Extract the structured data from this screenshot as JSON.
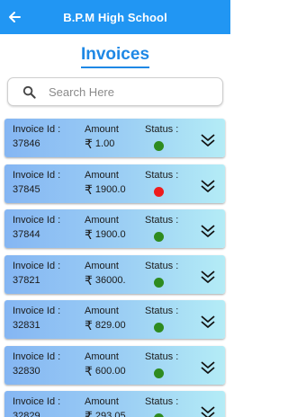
{
  "app_bar": {
    "title": "B.P.M High School",
    "back_icon": "arrow-left-icon"
  },
  "page_title": "Invoices",
  "search": {
    "placeholder": "Search Here",
    "icon": "search-icon"
  },
  "labels": {
    "invoice_id": "Invoice Id :",
    "amount": "Amount",
    "status": "Status :",
    "currency": "₹"
  },
  "colors": {
    "primary": "#2196f3",
    "status_paid": "#2e8b1f",
    "status_unpaid": "#ee1c1c"
  },
  "invoices": [
    {
      "id": "37846",
      "amount": "1.00",
      "status": "green"
    },
    {
      "id": "37845",
      "amount": "1900.0",
      "status": "red"
    },
    {
      "id": "37844",
      "amount": "1900.0",
      "status": "green"
    },
    {
      "id": "37821",
      "amount": "36000.",
      "status": "green"
    },
    {
      "id": "32831",
      "amount": "829.00",
      "status": "green"
    },
    {
      "id": "32830",
      "amount": "600.00",
      "status": "green"
    },
    {
      "id": "32829",
      "amount": "293.05",
      "status": "green"
    }
  ]
}
